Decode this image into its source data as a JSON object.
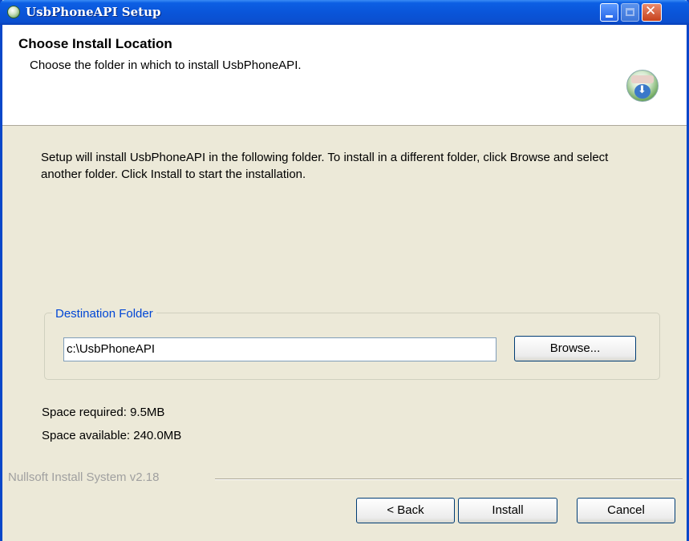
{
  "window": {
    "title": "UsbPhoneAPI Setup"
  },
  "header": {
    "title": "Choose Install Location",
    "subtitle": "Choose the folder in which to install UsbPhoneAPI."
  },
  "body": {
    "instructions": "Setup will install UsbPhoneAPI in the following folder. To install in a different folder, click Browse and select another folder. Click Install to start the installation.",
    "destination": {
      "legend": "Destination Folder",
      "path_value": "c:\\UsbPhoneAPI",
      "browse_label": "Browse..."
    },
    "space_required": "Space required: 9.5MB",
    "space_available": "Space available: 240.0MB"
  },
  "footer": {
    "branding": "Nullsoft Install System v2.18",
    "back_label": "< Back",
    "install_label": "Install",
    "cancel_label": "Cancel"
  },
  "icons": [
    "app-icon",
    "installer-logo-icon",
    "minimize-icon",
    "maximize-icon",
    "close-icon"
  ],
  "colors": {
    "titlebar": "#0a55d9",
    "legend_text": "#0046d5",
    "dialog_bg": "#ece9d8"
  }
}
